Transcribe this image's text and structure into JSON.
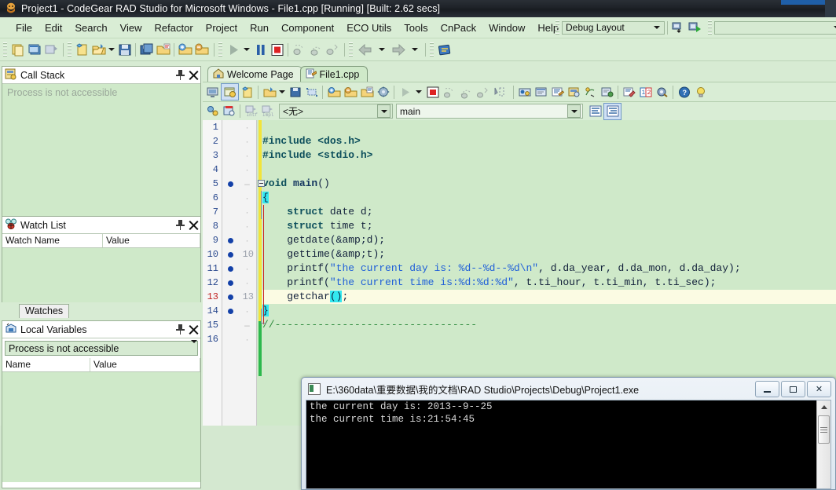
{
  "window": {
    "title": "Project1 - CodeGear RAD Studio for Microsoft Windows - File1.cpp [Running] [Built: 2.62 secs]",
    "icon": "rad-studio-icon"
  },
  "menubar": {
    "items": [
      {
        "label": "File"
      },
      {
        "label": "Edit"
      },
      {
        "label": "Search"
      },
      {
        "label": "View"
      },
      {
        "label": "Refactor"
      },
      {
        "label": "Project"
      },
      {
        "label": "Run"
      },
      {
        "label": "Component"
      },
      {
        "label": "ECO Utils"
      },
      {
        "label": "Tools"
      },
      {
        "label": "CnPack"
      },
      {
        "label": "Window"
      },
      {
        "label": "Help"
      }
    ],
    "layout_combo": {
      "value": "Debug Layout"
    },
    "search_combo": {
      "value": "",
      "placeholder": ""
    }
  },
  "panels": {
    "call_stack": {
      "title": "Call Stack",
      "icon": "call-stack-icon",
      "body_text": "Process is not accessible"
    },
    "watch_list": {
      "title": "Watch List",
      "icon": "watch-list-icon",
      "columns": [
        "Watch Name",
        "Value"
      ],
      "rows": [],
      "tab_label": "Watches"
    },
    "local_variables": {
      "title": "Local Variables",
      "icon": "local-variables-icon",
      "selector_value": "Process is not accessible",
      "columns": [
        "Name",
        "Value"
      ],
      "rows": []
    }
  },
  "editor": {
    "tabs": [
      {
        "label": "Welcome Page",
        "icon": "home-icon",
        "active": false
      },
      {
        "label": "File1.cpp",
        "icon": "cpp-file-icon",
        "active": true
      }
    ],
    "class_combo": {
      "value": "<无>"
    },
    "method_combo": {
      "value": "main"
    },
    "code_lines": [
      {
        "n": "1",
        "ln": "",
        "bp": false,
        "mod": "dot",
        "text": "",
        "current": false
      },
      {
        "n": "2",
        "ln": "",
        "bp": false,
        "mod": "dot",
        "text": "#include <dos.h>",
        "current": false
      },
      {
        "n": "3",
        "ln": "",
        "bp": false,
        "mod": "dot",
        "text": "#include <stdio.h>",
        "current": false
      },
      {
        "n": "4",
        "ln": "",
        "bp": false,
        "mod": "dot",
        "text": "",
        "current": false
      },
      {
        "n": "5",
        "ln": "",
        "bp": true,
        "mod": "dash",
        "text": "void main()",
        "current": false
      },
      {
        "n": "6",
        "ln": "",
        "bp": false,
        "mod": "dot",
        "text": "{",
        "current": false
      },
      {
        "n": "7",
        "ln": "",
        "bp": false,
        "mod": "dot",
        "text": "    struct date d;",
        "current": false
      },
      {
        "n": "8",
        "ln": "",
        "bp": false,
        "mod": "dot",
        "text": "    struct time t;",
        "current": false
      },
      {
        "n": "9",
        "ln": "",
        "bp": true,
        "mod": "dot",
        "text": "    getdate(&d);",
        "current": false
      },
      {
        "n": "10",
        "ln": "10",
        "bp": true,
        "mod": "",
        "text": "    gettime(&t);",
        "current": false
      },
      {
        "n": "11",
        "ln": "",
        "bp": true,
        "mod": "dot",
        "text": "    printf(\"the current day is: %d--%d--%d\\n\", d.da_year, d.da_mon, d.da_day);",
        "current": false
      },
      {
        "n": "12",
        "ln": "",
        "bp": true,
        "mod": "dot",
        "text": "    printf(\"the current time is:%d:%d:%d\", t.ti_hour, t.ti_min, t.ti_sec);",
        "current": false
      },
      {
        "n": "13",
        "ln": "13",
        "bp": true,
        "mod": "",
        "text": "    getchar();",
        "current": true
      },
      {
        "n": "14",
        "ln": "",
        "bp": true,
        "mod": "dot",
        "text": "}",
        "current": false
      },
      {
        "n": "15",
        "ln": "",
        "bp": false,
        "mod": "dash",
        "text": "//---------------------------------",
        "current": false
      },
      {
        "n": "16",
        "ln": "",
        "bp": false,
        "mod": "dot",
        "text": "",
        "current": false
      }
    ]
  },
  "console": {
    "title": "E:\\360data\\重要数据\\我的文档\\RAD Studio\\Projects\\Debug\\Project1.exe",
    "icon": "console-icon",
    "buttons": {
      "minimize": "minimize",
      "maximize": "maximize",
      "close": "✕"
    },
    "output": [
      "the current day is: 2013--9--25",
      "the current time is:21:54:45"
    ]
  },
  "colors": {
    "chrome_green": "#d9edd5",
    "editor_bg": "#cfe9c9",
    "keyword": "#0d4f5c",
    "string": "#1f5fd8",
    "comment": "#2e8b3d",
    "breakpoint": "#1340a8",
    "current_line": "#fbfbe3",
    "selection": "#33e8f0",
    "titlebar": "#1d2127"
  }
}
